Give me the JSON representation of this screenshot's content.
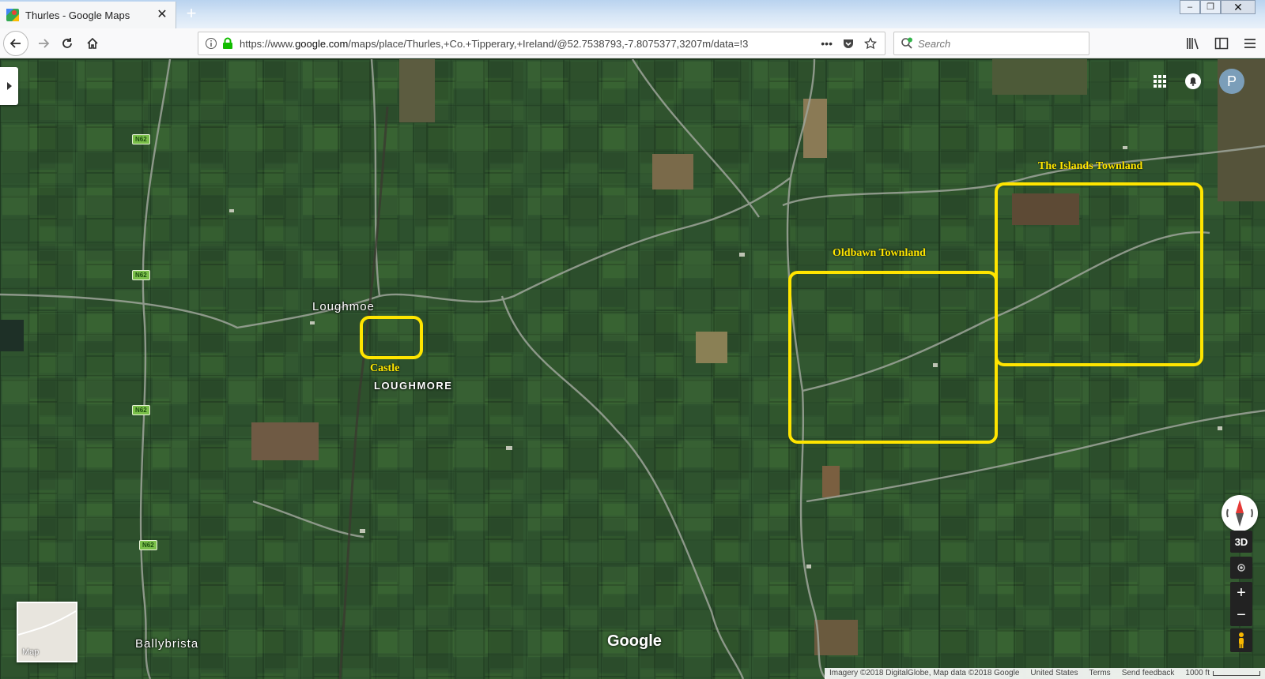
{
  "browser": {
    "tab_title": "Thurles - Google Maps",
    "new_tab": "+",
    "close_tab": "✕",
    "url_prefix": "https://www.",
    "url_domain": "google.com",
    "url_rest": "/maps/place/Thurles,+Co.+Tipperary,+Ireland/@52.7538793,-7.8075377,3207m/data=!3",
    "search_placeholder": "Search",
    "url_more": "•••",
    "window_minimize": "‒",
    "window_restore": "❐",
    "window_close": "✕"
  },
  "map": {
    "user_initial": "P",
    "places": {
      "loughmoe": "Loughmoe",
      "loughmore": "LOUGHMORE",
      "ballybrista": "Ballybrista"
    },
    "road_shields": [
      "N62",
      "N62",
      "N62",
      "N62"
    ],
    "annotations": {
      "castle": "Castle",
      "oldbawn": "Oldbawn Townland",
      "islands": "The Islands Townland"
    },
    "map_type_label": "Map",
    "google_logo": "Google",
    "btn_3d": "3D",
    "zoom_in": "+",
    "zoom_out": "−",
    "attribution": {
      "imagery": "Imagery ©2018 DigitalGlobe, Map data ©2018 Google",
      "region": "United States",
      "terms": "Terms",
      "feedback": "Send feedback",
      "scale": "1000 ft"
    },
    "annotation_color": "#ffe500"
  }
}
